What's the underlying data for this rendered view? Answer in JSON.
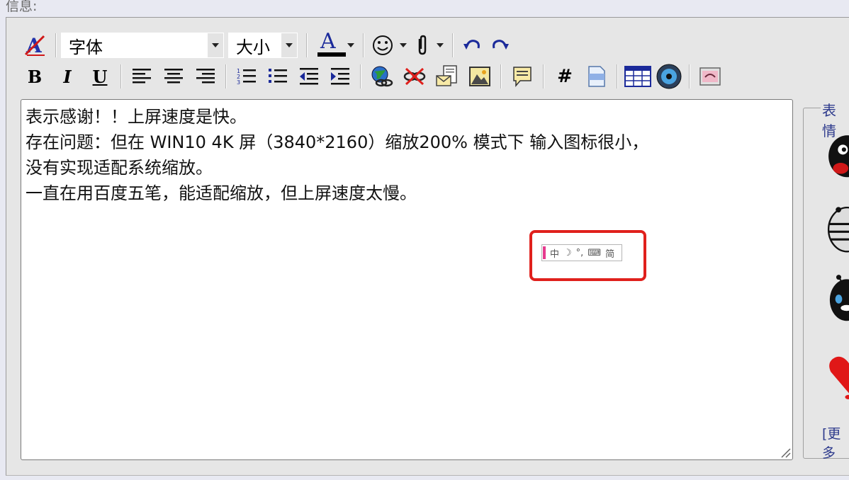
{
  "header": {
    "label": "信息:"
  },
  "toolbar": {
    "font_select": "字体",
    "size_select": "大小",
    "font_color_letter": "A",
    "bold": "B",
    "italic": "I",
    "underline": "U",
    "hash": "#"
  },
  "editor": {
    "lines": [
      "表示感谢！！上屏速度是快。",
      "存在问题：但在 WIN10 4K 屏（3840*2160）缩放200% 模式下 输入图标很小，",
      "没有实现适配系统缩放。",
      "一直在用百度五笔，能适配缩放，但上屏速度太慢。"
    ]
  },
  "ime_toolbar": {
    "lang": "中",
    "punct": "°,",
    "charset": "简"
  },
  "emoticons": {
    "legend": "表情",
    "more_link": "[更多"
  },
  "colors": {
    "accent_red": "#e0201c",
    "link_blue": "#2d3a8c",
    "ime_marker": "#e63a8e"
  }
}
